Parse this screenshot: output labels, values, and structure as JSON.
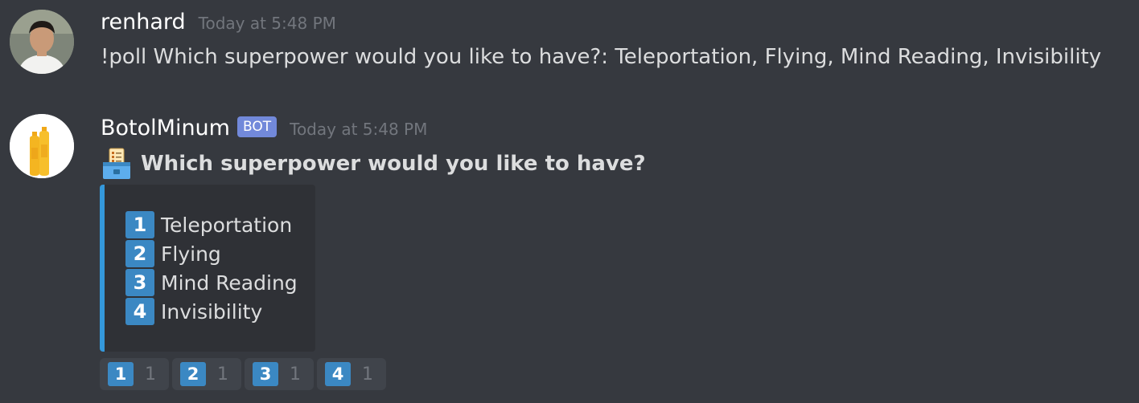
{
  "messages": [
    {
      "username": "renhard",
      "timestamp": "Today at 5:48 PM",
      "content": "!poll Which superpower would you like to have?: Teleportation, Flying, Mind Reading, Invisibility"
    },
    {
      "username": "BotolMinum",
      "bot_tag": "BOT",
      "timestamp": "Today at 5:48 PM",
      "poll_icon": "ballot-box-icon",
      "poll_title": "Which superpower would you like to have?",
      "embed_color": "#3498db",
      "options": [
        {
          "key": "1",
          "label": "Teleportation"
        },
        {
          "key": "2",
          "label": "Flying"
        },
        {
          "key": "3",
          "label": "Mind Reading"
        },
        {
          "key": "4",
          "label": "Invisibility"
        }
      ],
      "reactions": [
        {
          "emoji": "1",
          "count": "1"
        },
        {
          "emoji": "2",
          "count": "1"
        },
        {
          "emoji": "3",
          "count": "1"
        },
        {
          "emoji": "4",
          "count": "1"
        }
      ]
    }
  ]
}
